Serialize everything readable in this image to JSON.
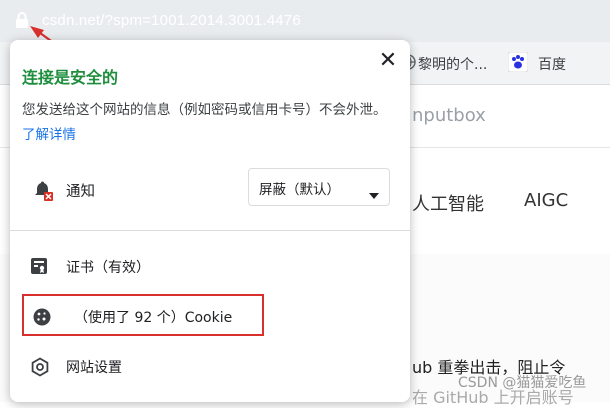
{
  "browser": {
    "url": "csdn.net/?spm=1001.2014.3001.4476",
    "bookmarks": [
      {
        "label": "黎明的个..."
      },
      {
        "label": "百度"
      }
    ]
  },
  "background": {
    "search_text": "nputbox",
    "nav_items": [
      "人工智能",
      "AIGC"
    ],
    "article_line": "ub 重拳出击，阻止令",
    "article_line2": "在 GitHub 上开启账号",
    "watermark": "CSDN @猫猫爱吃鱼"
  },
  "popup": {
    "title": "连接是安全的",
    "close_label": "✕",
    "description": "您发送给这个网站的信息（例如密码或信用卡号）不会外泄。",
    "learn_more": "了解详情",
    "notification_label": "通知",
    "notification_select": "屏蔽（默认）",
    "certificate_label": "证书（有效）",
    "cookie_label": "（使用了 92 个）Cookie",
    "site_settings_label": "网站设置"
  },
  "colors": {
    "secure_title": "#1e8e3e",
    "link": "#1a73e8",
    "highlight": "#d9302e",
    "arrow": "#d9302e"
  }
}
